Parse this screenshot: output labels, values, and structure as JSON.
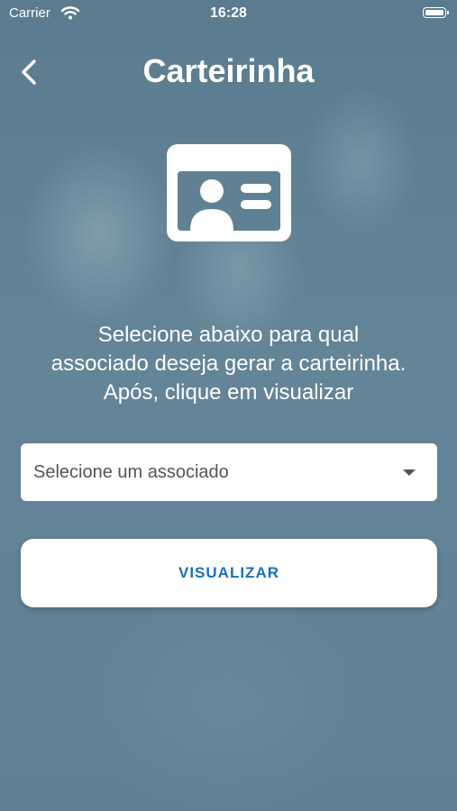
{
  "status_bar": {
    "carrier": "Carrier",
    "time": "16:28"
  },
  "nav": {
    "title": "Carteirinha",
    "back_icon": "chevron-left-icon"
  },
  "hero": {
    "icon": "id-card-icon"
  },
  "instructions": {
    "line1": "Selecione abaixo para qual",
    "line2": "associado deseja gerar a carteirinha.",
    "line3": "Após, clique em visualizar"
  },
  "member_select": {
    "placeholder": "Selecione um associado",
    "icon": "caret-down-icon"
  },
  "actions": {
    "view_label": "VISUALIZAR"
  },
  "colors": {
    "background": "#5d7f92",
    "accent": "#1a6fb0",
    "surface": "#ffffff"
  }
}
